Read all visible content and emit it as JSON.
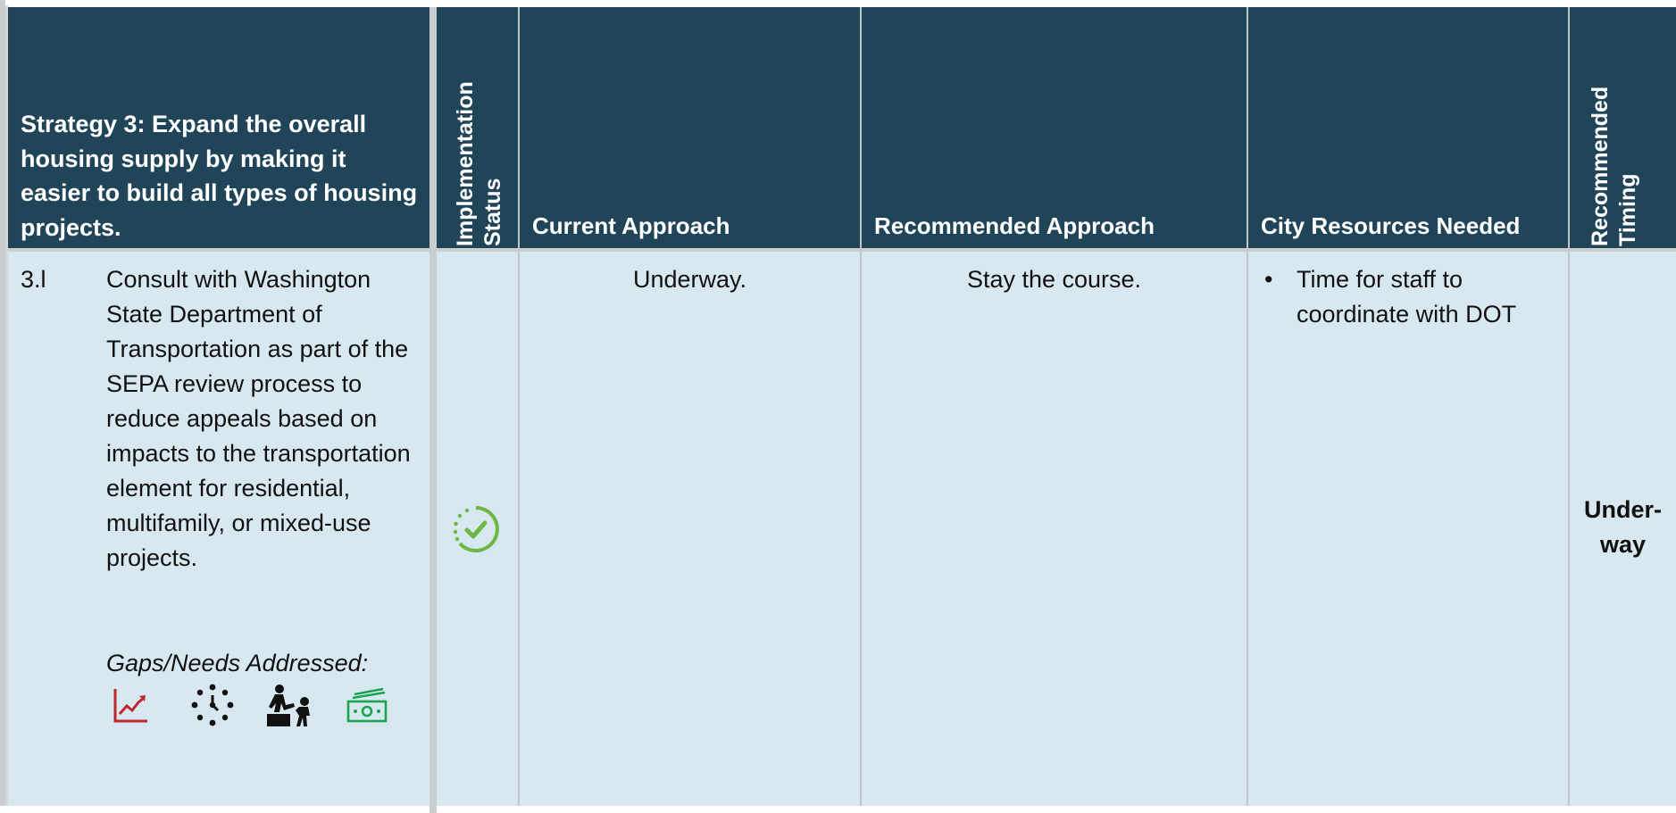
{
  "header": {
    "strategy_title": "Strategy 3: Expand the overall housing supply by making it easier to build all types of housing projects.",
    "implementation_status": [
      "Implementation",
      "Status"
    ],
    "current_approach": "Current Approach",
    "recommended_approach": "Recommended Approach",
    "city_resources_needed": "City Resources Needed",
    "recommended_timing": [
      "Recommended",
      "Timing"
    ]
  },
  "row": {
    "number": "3.l",
    "description": "Consult with Washington State Department of Transportation as part of the SEPA review process to reduce appeals based on impacts to the transportation element for residential, multifamily, or mixed-use projects.",
    "gaps_label": "Gaps/Needs Addressed:",
    "gap_icons": [
      "trend-chart-icon",
      "dotted-circle-clock-icon",
      "helping-hand-climb-icon",
      "money-stack-icon"
    ],
    "status_icon": "underway-check-icon",
    "current_approach": "Underway.",
    "recommended_approach": "Stay the course.",
    "resources": [
      "Time for staff to coordinate with DOT"
    ],
    "bullet_symbol": "•",
    "timing": "Under-way"
  },
  "colors": {
    "header_bg": "#204458",
    "body_bg": "#d8e8f0",
    "status_green": "#6fb744",
    "chart_red": "#c0262d",
    "money_green": "#1aa650"
  }
}
